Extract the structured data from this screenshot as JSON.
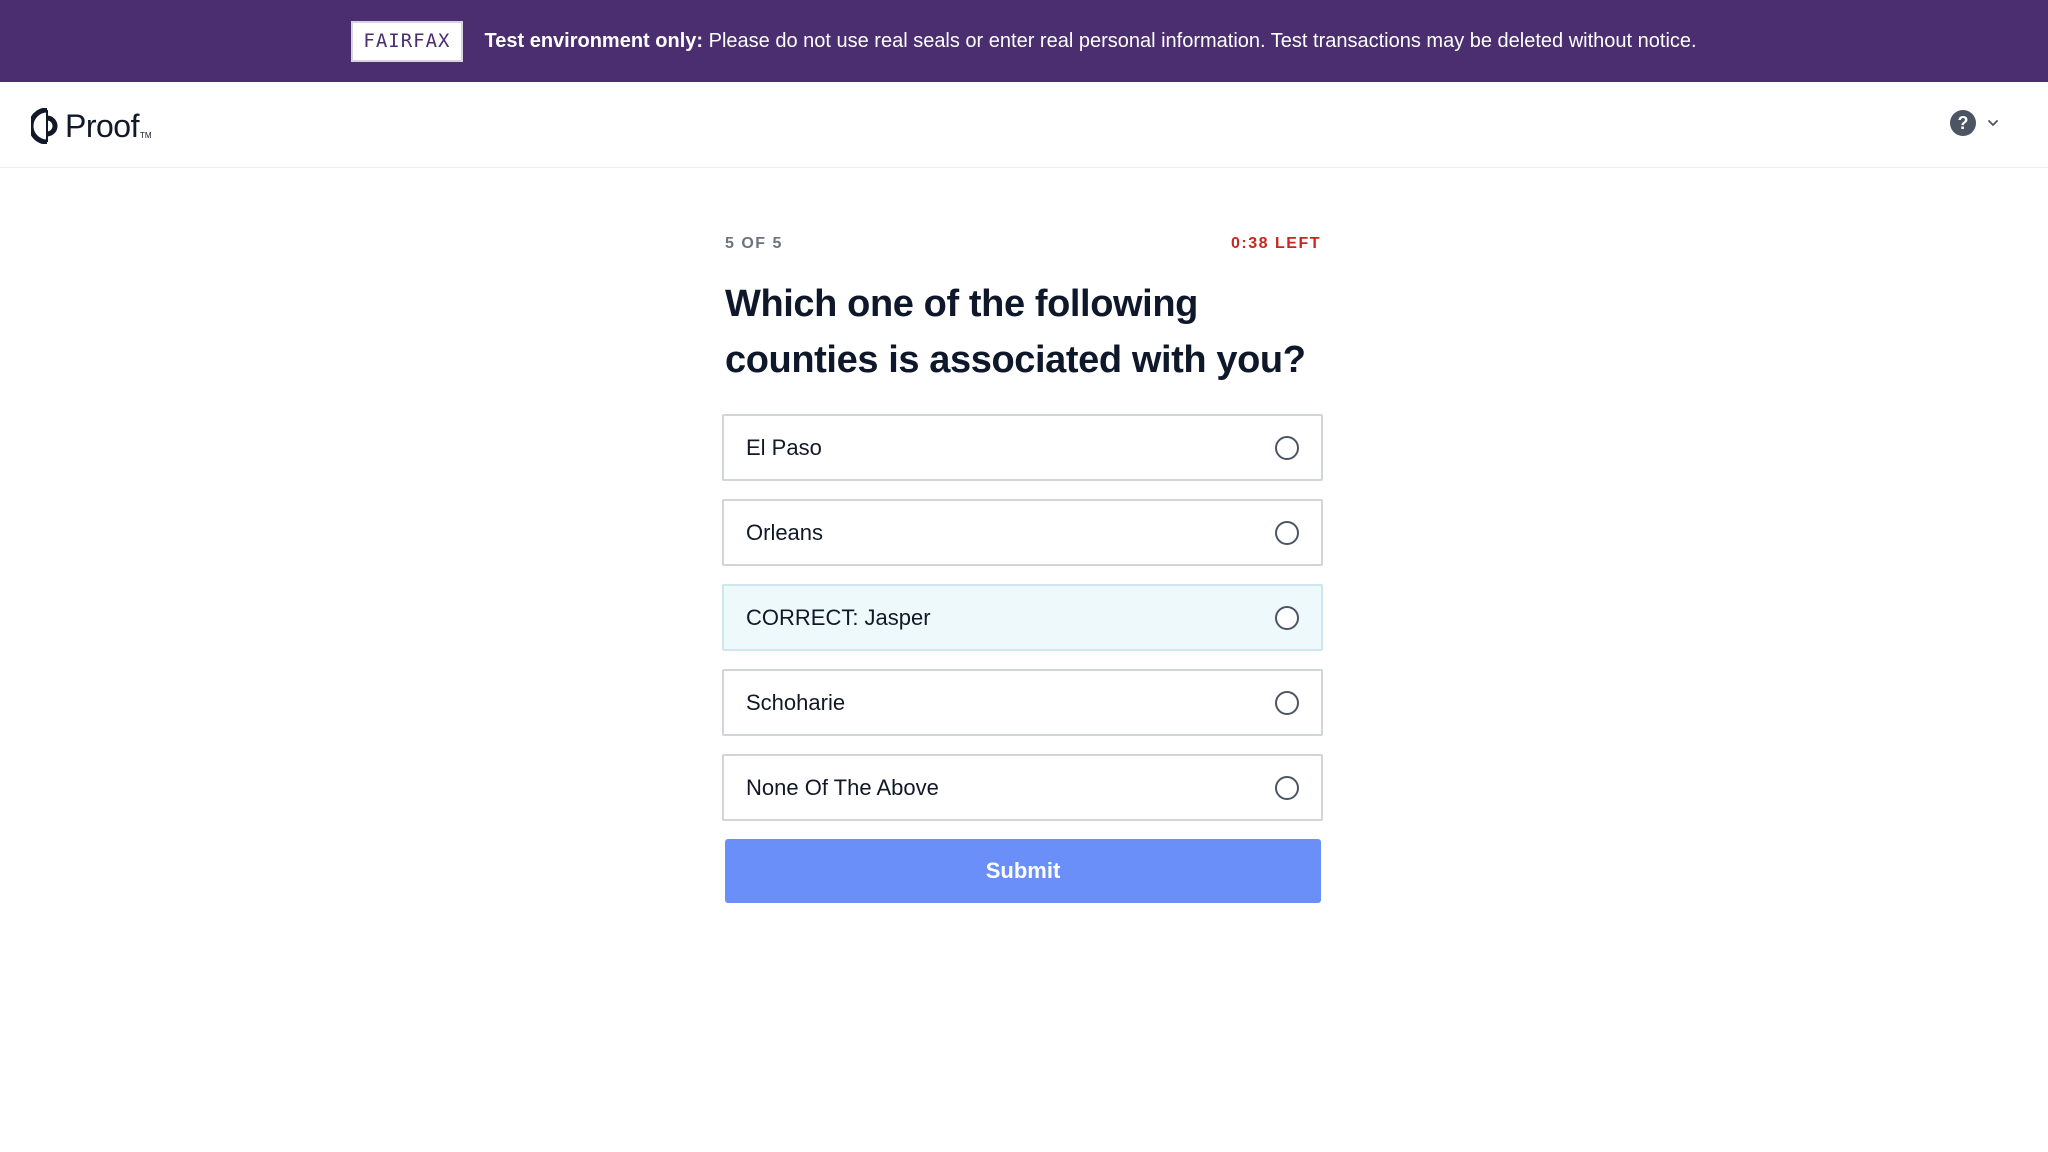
{
  "banner": {
    "badge": "FAIRFAX",
    "bold_text": "Test environment only:",
    "message": "Please do not use real seals or enter real personal information. Test transactions may be deleted without notice.",
    "background_color": "#4b2e6f"
  },
  "header": {
    "logo_text": "Proof",
    "logo_tm": "TM",
    "help_icon": "question-circle-icon",
    "help_symbol": "?",
    "dropdown_icon": "chevron-down-icon"
  },
  "quiz": {
    "progress": "5 OF 5",
    "timer": "0:38 LEFT",
    "timer_color": "#c5281c",
    "question": "Which one of the following counties is associated with you?",
    "options": [
      {
        "label": "El Paso"
      },
      {
        "label": "Orleans"
      },
      {
        "label": "CORRECT: Jasper"
      },
      {
        "label": "Schoharie"
      },
      {
        "label": "None Of The Above"
      }
    ],
    "submit_label": "Submit",
    "submit_color": "#6b8ff8"
  }
}
